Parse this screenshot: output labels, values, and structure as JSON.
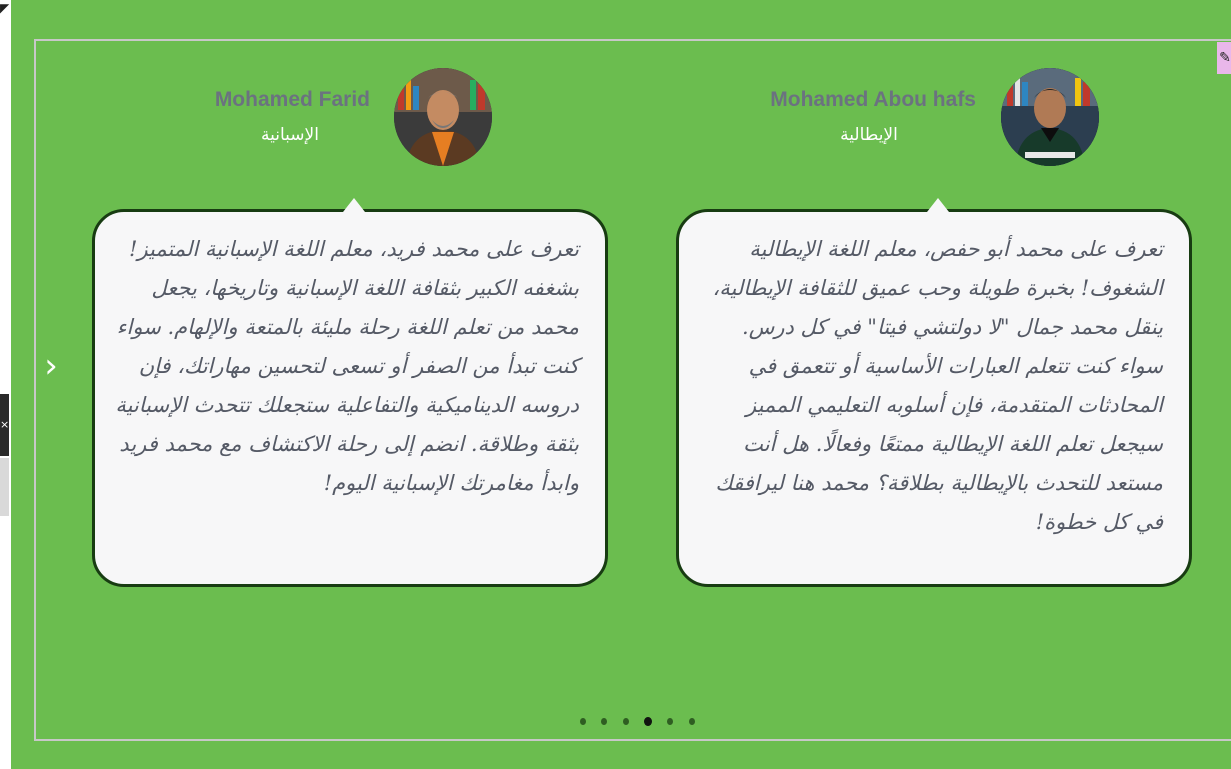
{
  "carousel": {
    "prev_arrow": "›",
    "next_arrow": "‹",
    "pager": {
      "count": 6,
      "active_index": 3
    },
    "testimonials": [
      {
        "name": "Mohamed Abou hafs",
        "language": "الإيطالية",
        "text": "تعرف على محمد أبو حفص، معلم اللغة الإيطالية الشغوف! بخبرة طويلة وحب عميق للثقافة الإيطالية، ينقل محمد جمال \"لا دولتشي فيتا\" في كل درس. سواء كنت تتعلم العبارات الأساسية أو تتعمق في المحادثات المتقدمة، فإن أسلوبه التعليمي المميز سيجعل تعلم اللغة الإيطالية ممتعًا وفعالًا. هل أنت مستعد للتحدث بالإيطالية بطلاقة؟ محمد هنا ليرافقك في كل خطوة!"
      },
      {
        "name": "Mohamed Farid",
        "language": "الإسبانية",
        "text": "تعرف على محمد فريد، معلم اللغة الإسبانية المتميز! بشغفه الكبير بثقافة اللغة الإسبانية وتاريخها، يجعل محمد من تعلم اللغة رحلة مليئة بالمتعة والإلهام. سواء كنت تبدأ من الصفر أو تسعى لتحسين مهاراتك، فإن دروسه الديناميكية والتفاعلية ستجعلك تتحدث الإسبانية بثقة وطلاقة. انضم إلى رحلة الاكتشاف مع محمد فريد وابدأ مغامرتك الإسبانية اليوم!"
      }
    ]
  },
  "colors": {
    "background": "#6bbd4f",
    "bubble_border": "#183c12",
    "bubble_fill": "#f7f7f8",
    "name": "#6b7280",
    "language": "#ffffff"
  }
}
